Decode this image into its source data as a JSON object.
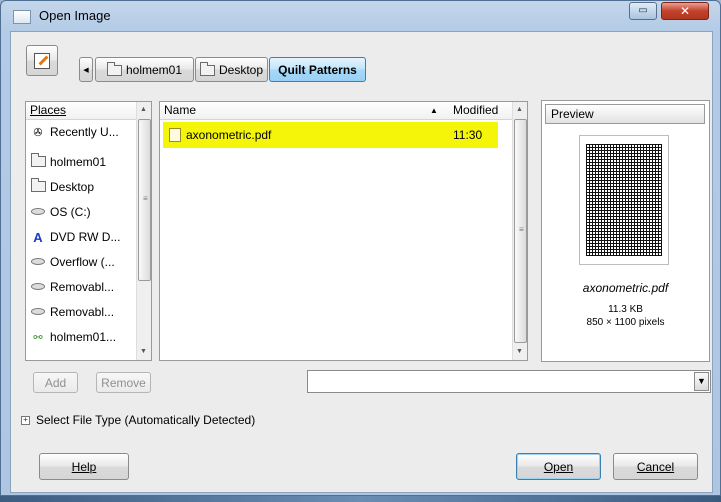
{
  "window": {
    "title": "Open Image"
  },
  "toolbar": {
    "breadcrumbs": [
      "holmem01",
      "Desktop",
      "Quilt Patterns"
    ]
  },
  "places": {
    "header": "Places",
    "items": [
      {
        "label": "Recently U...",
        "icon": "recent-icon"
      },
      {
        "label": "holmem01",
        "icon": "folder-icon"
      },
      {
        "label": "Desktop",
        "icon": "folder-icon"
      },
      {
        "label": "OS (C:)",
        "icon": "drive-icon"
      },
      {
        "label": "DVD RW D...",
        "icon": "dvd-icon"
      },
      {
        "label": "Overflow (...",
        "icon": "drive-icon"
      },
      {
        "label": "Removabl...",
        "icon": "drive-icon"
      },
      {
        "label": "Removabl...",
        "icon": "drive-icon"
      },
      {
        "label": "holmem01...",
        "icon": "network-drive-icon"
      }
    ],
    "add_label": "Add",
    "remove_label": "Remove"
  },
  "files": {
    "col_name": "Name",
    "col_modified": "Modified",
    "rows": [
      {
        "name": "axonometric.pdf",
        "modified": "11:30"
      }
    ]
  },
  "preview": {
    "title": "Preview",
    "filename": "axonometric.pdf",
    "size": "11.3 KB",
    "dimensions": "850 × 1100 pixels"
  },
  "filter": {
    "label": "Select File Type (Automatically Detected)"
  },
  "buttons": {
    "help": "Help",
    "open": "Open",
    "cancel": "Cancel"
  },
  "colors": {
    "selection_highlight": "#f5f50a",
    "active_breadcrumb": "#a7d9f8"
  }
}
